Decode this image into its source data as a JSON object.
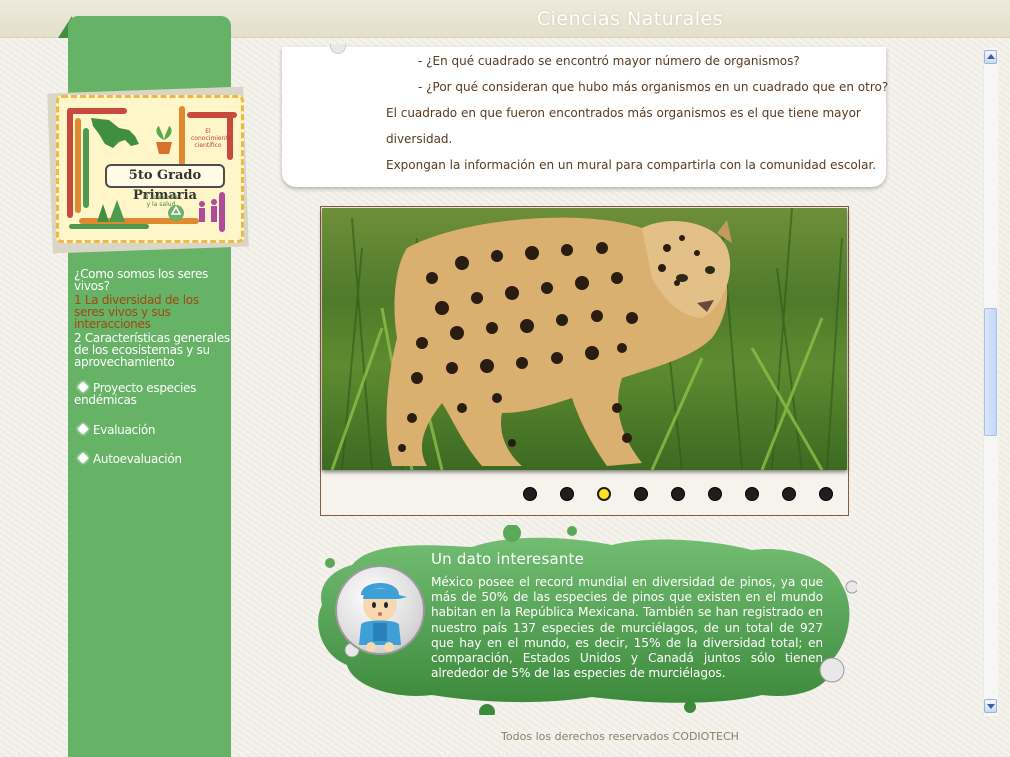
{
  "header": {
    "title": "Ciencias Naturales"
  },
  "badge": {
    "title": "5to Grado Primaria",
    "tag_top": "El conocimiento científico",
    "tag_bottom": "El ambiente y la salud"
  },
  "nav": {
    "items": [
      {
        "label": "¿Como somos los seres vivos?",
        "active": false,
        "bullet": false
      },
      {
        "label": "1 La diversidad de los seres vivos y sus interacciones",
        "active": true,
        "bullet": false
      },
      {
        "label": "2 Características generales de los ecosistemas y su aprovechamiento",
        "active": false,
        "bullet": false
      },
      {
        "label": "Proyecto especies endémicas",
        "active": false,
        "bullet": true
      },
      {
        "label": "Evaluación",
        "active": false,
        "bullet": true
      },
      {
        "label": "Autoevaluación",
        "active": false,
        "bullet": true
      }
    ]
  },
  "content": {
    "lines": [
      "- ¿En qué cuadrado se encontró mayor número de organismos?",
      "- ¿Por qué consideran que hubo más organismos en un cuadrado que en otro?",
      "El cuadrado en que fueron encontrados más organismos es el que tiene mayor",
      "diversidad.",
      "Expongan la información en un mural para compartirla con la comunidad escolar."
    ]
  },
  "slideshow": {
    "image_subject": "jaguar",
    "total_slides": 9,
    "active_slide": 3
  },
  "fact": {
    "title": "Un dato interesante",
    "text": "México posee el record mundial en diversidad de pinos, ya que más de 50% de las especies de pinos que existen en el mundo habitan en la República Mexicana. También se han registrado en nuestro país 137 especies de murciélagos, de un total de 927 que hay en el mundo, es decir, 15% de la diversidad total; en comparación, Estados Unidos y Canadá juntos sólo tienen alrededor de 5% de las especies de murciélagos."
  },
  "footer": {
    "text": "Todos los derechos reservados CODIOTECH"
  },
  "colors": {
    "sidebar": "#66b266",
    "active_nav": "#a04a10",
    "bubble": "#5aa85a",
    "active_dot": "#ffe21a"
  }
}
